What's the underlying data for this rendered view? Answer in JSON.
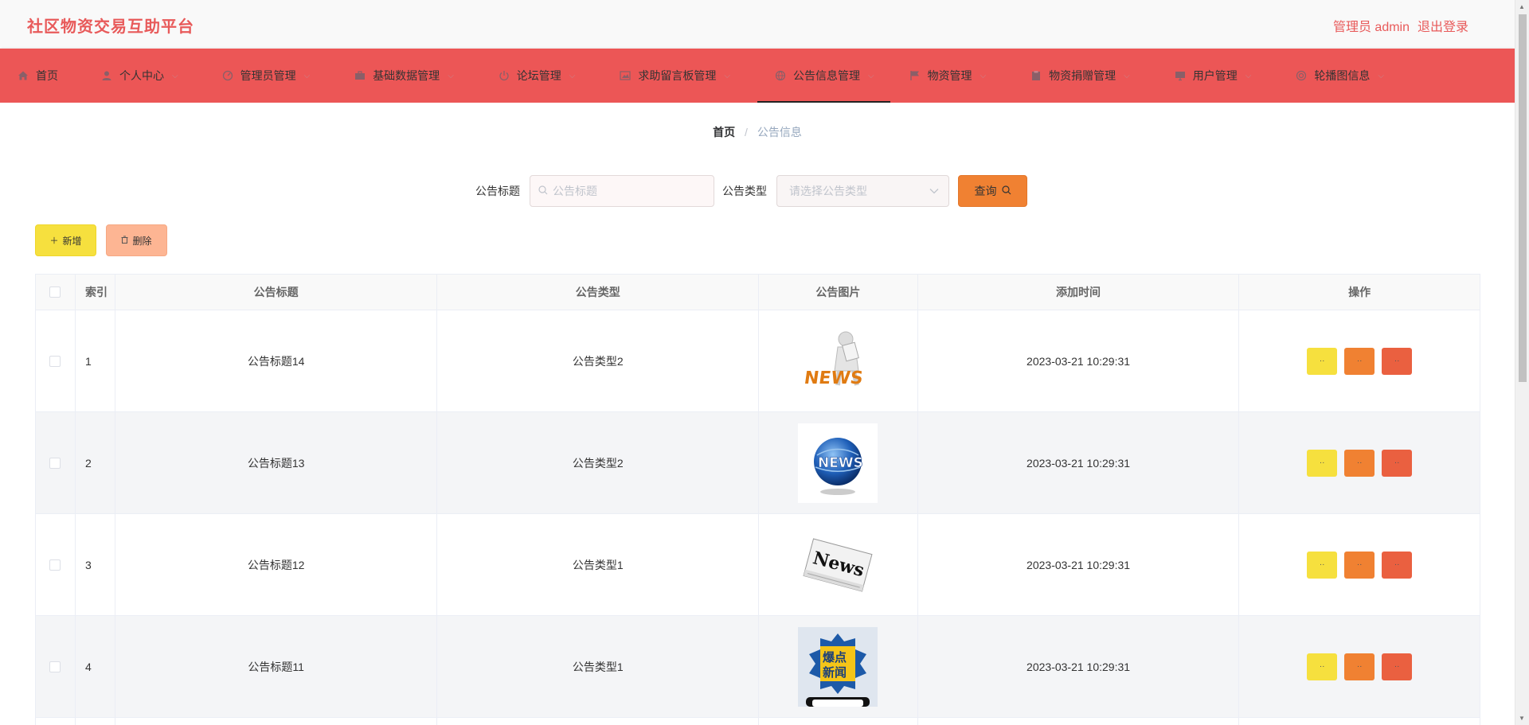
{
  "header": {
    "brand": "社区物资交易互助平台",
    "admin": "管理员 admin",
    "logout": "退出登录"
  },
  "nav": {
    "items": [
      {
        "label": "首页",
        "icon": "home-icon",
        "dropdown": false
      },
      {
        "label": "个人中心",
        "icon": "user-icon",
        "dropdown": true
      },
      {
        "label": "管理员管理",
        "icon": "gauge-icon",
        "dropdown": true
      },
      {
        "label": "基础数据管理",
        "icon": "briefcase-icon",
        "dropdown": true
      },
      {
        "label": "论坛管理",
        "icon": "power-icon",
        "dropdown": true
      },
      {
        "label": "求助留言板管理",
        "icon": "picture-icon",
        "dropdown": true
      },
      {
        "label": "公告信息管理",
        "icon": "globe-icon",
        "dropdown": true,
        "active": true
      },
      {
        "label": "物资管理",
        "icon": "flag-icon",
        "dropdown": true
      },
      {
        "label": "物资捐赠管理",
        "icon": "clipboard-icon",
        "dropdown": true
      },
      {
        "label": "用户管理",
        "icon": "monitor-icon",
        "dropdown": true
      },
      {
        "label": "轮播图信息",
        "icon": "target-icon",
        "dropdown": true
      }
    ]
  },
  "breadcrumb": {
    "home": "首页",
    "separator": "/",
    "current": "公告信息"
  },
  "search": {
    "title_label": "公告标题",
    "title_placeholder": "公告标题",
    "type_label": "公告类型",
    "type_placeholder": "请选择公告类型",
    "query_label": "查询"
  },
  "actions": {
    "add_label": "新增",
    "delete_label": "删除"
  },
  "table": {
    "headers": [
      "",
      "索引",
      "公告标题",
      "公告类型",
      "公告图片",
      "添加时间",
      "操作"
    ],
    "rows": [
      {
        "index": "1",
        "title": "公告标题14",
        "type": "公告类型2",
        "image": "news-person-image",
        "time": "2023-03-21 10:29:31"
      },
      {
        "index": "2",
        "title": "公告标题13",
        "type": "公告类型2",
        "image": "news-globe-image",
        "time": "2023-03-21 10:29:31"
      },
      {
        "index": "3",
        "title": "公告标题12",
        "type": "公告类型1",
        "image": "newspaper-image",
        "time": "2023-03-21 10:29:31"
      },
      {
        "index": "4",
        "title": "公告标题11",
        "type": "公告类型1",
        "image": "breaking-news-image",
        "time": "2023-03-21 10:29:31"
      }
    ],
    "op_labels": {
      "view": "··",
      "edit": "··",
      "delete": "··"
    }
  },
  "colors": {
    "brand": "#e85a5a",
    "nav_bg": "#ec5656",
    "query_btn": "#f08132",
    "add_btn": "#f6e03e",
    "delete_btn": "#fdb593",
    "op_view": "#f6e03e",
    "op_edit": "#f08132",
    "op_delete": "#ea6040"
  },
  "image_text": {
    "news1": "NEWS",
    "news2": "NEWS",
    "news3": "News",
    "news4_line1": "爆点",
    "news4_line2": "新闻"
  }
}
